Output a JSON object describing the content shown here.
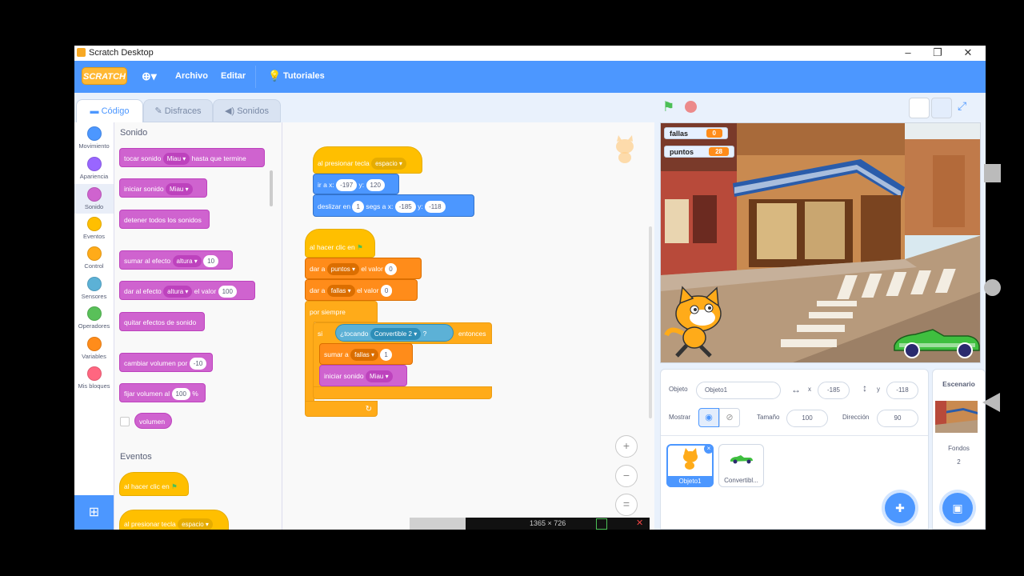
{
  "window": {
    "title": "Scratch Desktop"
  },
  "menubar": {
    "logo": "SCRATCH",
    "archivo": "Archivo",
    "editar": "Editar",
    "tutoriales": "Tutoriales"
  },
  "tabs": {
    "codigo": "Código",
    "disfraces": "Disfraces",
    "sonidos": "Sonidos"
  },
  "categories": [
    {
      "label": "Movimiento",
      "color": "#4c97ff"
    },
    {
      "label": "Apariencia",
      "color": "#9966ff"
    },
    {
      "label": "Sonido",
      "color": "#cf63cf"
    },
    {
      "label": "Eventos",
      "color": "#ffbf00"
    },
    {
      "label": "Control",
      "color": "#ffab19"
    },
    {
      "label": "Sensores",
      "color": "#5cb1d6"
    },
    {
      "label": "Operadores",
      "color": "#59c059"
    },
    {
      "label": "Variables",
      "color": "#ff8c1a"
    },
    {
      "label": "Mis bloques",
      "color": "#ff6680"
    }
  ],
  "palette": {
    "sonido_header": "Sonido",
    "eventos_header": "Eventos",
    "b1": {
      "t1": "tocar sonido",
      "d": "Miau",
      "t2": "hasta que termine"
    },
    "b2": {
      "t1": "iniciar sonido",
      "d": "Miau"
    },
    "b3": {
      "t1": "detener todos los sonidos"
    },
    "b4": {
      "t1": "sumar al efecto",
      "d": "altura",
      "v": "10"
    },
    "b5": {
      "t1": "dar al efecto",
      "d": "altura",
      "t2": "el valor",
      "v": "100"
    },
    "b6": {
      "t1": "quitar efectos de sonido"
    },
    "b7": {
      "t1": "cambiar volumen por",
      "v": "-10"
    },
    "b8": {
      "t1": "fijar volumen al",
      "v": "100",
      "t2": "%"
    },
    "b9": {
      "t1": "volumen"
    },
    "e1": {
      "t1": "al hacer clic en"
    },
    "e2": {
      "t1": "al presionar tecla",
      "d": "espacio"
    }
  },
  "script1": {
    "hat": {
      "t1": "al presionar tecla",
      "d": "espacio"
    },
    "goto": {
      "t1": "ir a x:",
      "x": "-197",
      "t2": "y:",
      "y": "120"
    },
    "glide": {
      "t1": "deslizar en",
      "s": "1",
      "t2": "segs a x:",
      "x": "-185",
      "t3": "y:",
      "y": "-118"
    }
  },
  "script2": {
    "hat": {
      "t1": "al hacer clic en"
    },
    "set1": {
      "t1": "dar a",
      "d": "puntos",
      "t2": "el valor",
      "v": "0"
    },
    "set2": {
      "t1": "dar a",
      "d": "fallas",
      "t2": "el valor",
      "v": "0"
    },
    "forever": "por siempre",
    "if": {
      "t1": "si",
      "cond": "¿tocando",
      "d": "Convertible 2",
      "q": "?",
      "t2": "entonces"
    },
    "change": {
      "t1": "sumar a",
      "d": "fallas",
      "v": "1"
    },
    "sound": {
      "t1": "iniciar sonido",
      "d": "Miau"
    }
  },
  "zoom": {
    "in": "+",
    "out": "−",
    "reset": "="
  },
  "monitors": [
    {
      "label": "fallas",
      "value": "0"
    },
    {
      "label": "puntos",
      "value": "28"
    }
  ],
  "sprite": {
    "objeto_label": "Objeto",
    "objeto_value": "Objeto1",
    "x_label": "x",
    "x_value": "-185",
    "y_label": "y",
    "y_value": "-118",
    "mostrar_label": "Mostrar",
    "tamano_label": "Tamaño",
    "tamano_value": "100",
    "direccion_label": "Dirección",
    "direccion_value": "90"
  },
  "sprites": [
    {
      "name": "Objeto1",
      "selected": true
    },
    {
      "name": "Convertibl..."
    }
  ],
  "stage_panel": {
    "title": "Escenario",
    "fondos_label": "Fondos",
    "fondos_count": "2"
  },
  "overlay": {
    "dims": "1365 × 726"
  }
}
